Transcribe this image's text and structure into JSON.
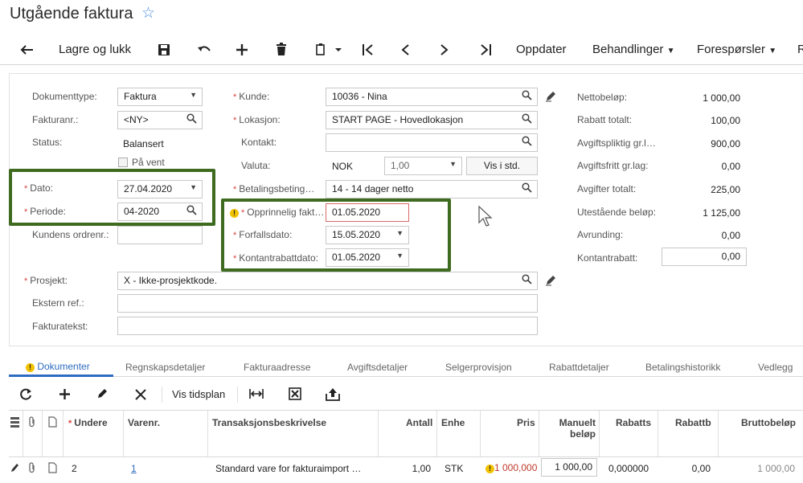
{
  "page": {
    "title": "Utgående faktura"
  },
  "toolbar": {
    "save_close": "Lagre og lukk",
    "update": "Oppdater",
    "actions": "Behandlinger",
    "inquiries": "Forespørsler",
    "overflow": "R"
  },
  "form": {
    "doctype_label": "Dokumenttype:",
    "doctype_value": "Faktura",
    "invoiceno_label": "Fakturanr.:",
    "invoiceno_value": "<NY>",
    "status_label": "Status:",
    "status_value": "Balansert",
    "onhold_label": "På vent",
    "date_label": "Dato:",
    "date_value": "27.04.2020",
    "period_label": "Periode:",
    "period_value": "04-2020",
    "custorder_label": "Kundens ordrenr.:",
    "customer_label": "Kunde:",
    "customer_value": "10036 - Nina",
    "location_label": "Lokasjon:",
    "location_value": "START PAGE - Hovedlokasjon",
    "contact_label": "Kontakt:",
    "currency_label": "Valuta:",
    "currency_value": "NOK",
    "rate_value": "1,00",
    "rate_button": "Vis i std.",
    "terms_label": "Betalingsbeting…",
    "terms_value": "14 - 14 dager netto",
    "origdate_label": "Opprinnelig fakt…",
    "origdate_value": "01.05.2020",
    "duedate_label": "Forfallsdato:",
    "duedate_value": "15.05.2020",
    "discdate_label": "Kontantrabattdato:",
    "discdate_value": "01.05.2020",
    "project_label": "Prosjekt:",
    "project_value": "X - Ikke-prosjektkode.",
    "extref_label": "Ekstern ref.:",
    "invtext_label": "Fakturatekst:"
  },
  "totals": [
    {
      "label": "Nettobeløp:",
      "value": "1 000,00"
    },
    {
      "label": "Rabatt totalt:",
      "value": "100,00"
    },
    {
      "label": "Avgiftspliktig gr.l…",
      "value": "900,00"
    },
    {
      "label": "Avgiftsfritt gr.lag:",
      "value": "0,00"
    },
    {
      "label": "Avgifter totalt:",
      "value": "225,00"
    },
    {
      "label": "Utestående beløp:",
      "value": "1 125,00"
    },
    {
      "label": "Avrunding:",
      "value": "0,00"
    },
    {
      "label": "Kontantrabatt:",
      "value": "0,00"
    }
  ],
  "tabs": [
    "Dokumenter",
    "Regnskapsdetaljer",
    "Fakturaadresse",
    "Avgiftsdetaljer",
    "Selgerprovisjon",
    "Rabattdetaljer",
    "Betalingshistorikk",
    "Vedlegg"
  ],
  "grid_toolbar": {
    "schedule": "Vis tidsplan"
  },
  "grid": {
    "headers": {
      "line": "Undere",
      "item": "Varenr.",
      "desc": "Transaksjonsbeskrivelse",
      "qty": "Antall",
      "uom": "Enhe",
      "price": "Pris",
      "manual_1": "Manuelt",
      "manual_2": "beløp",
      "discpct": "Rabatts",
      "discamt": "Rabattb",
      "gross": "Bruttobeløp"
    },
    "rows": [
      {
        "line": "2",
        "item": "1",
        "desc": "Standard vare for fakturaimport …",
        "qty": "1,00",
        "uom": "STK",
        "price": "1 000,000",
        "manual": "1 000,00",
        "discpct": "0,000000",
        "discamt": "0,00",
        "gross": "1 000,00"
      }
    ]
  },
  "colors": {
    "accent": "#2d6cc0",
    "highlight_box": "#3e6b1f",
    "required": "#d64541",
    "warning": "#f2c200"
  }
}
